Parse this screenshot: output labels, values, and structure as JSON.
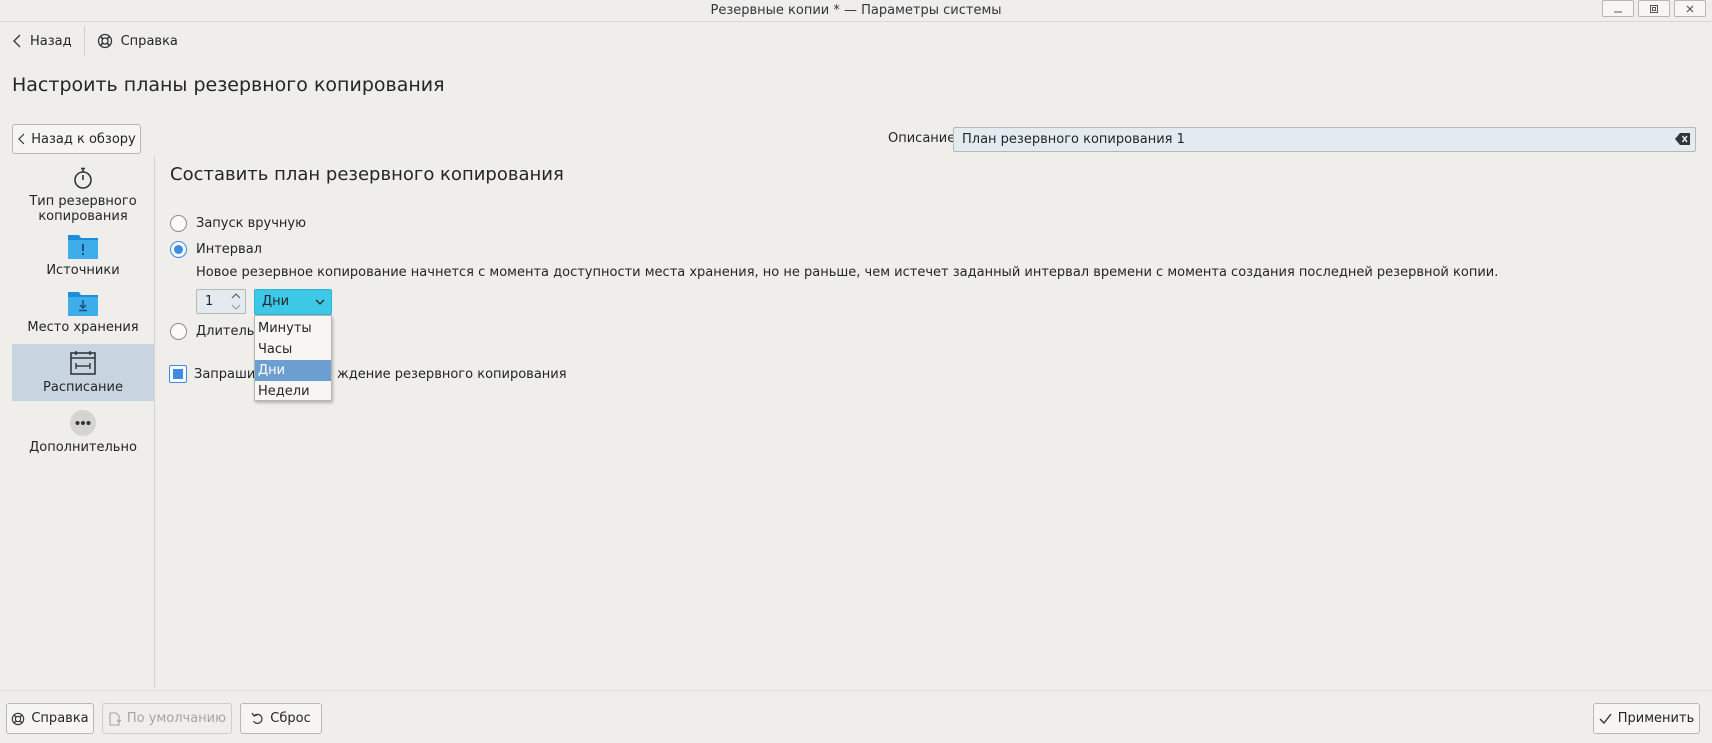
{
  "window": {
    "title": "Резервные копии * — Параметры системы"
  },
  "toolbar": {
    "back_label": "Назад",
    "help_label": "Справка"
  },
  "page": {
    "title": "Настроить планы резервного копирования",
    "back_to_overview_label": "Назад к обзору",
    "description_label": "Описание:",
    "description_value": "План резервного копирования 1"
  },
  "sidebar": {
    "items": [
      {
        "label": "Тип резервного копирования",
        "icon": "timer-icon"
      },
      {
        "label": "Источники",
        "icon": "folder-icon"
      },
      {
        "label": "Место хранения",
        "icon": "folder-download-icon"
      },
      {
        "label": "Расписание",
        "icon": "calendar-icon",
        "active": true
      },
      {
        "label": "Дополнительно",
        "icon": "more-icon"
      }
    ]
  },
  "schedule": {
    "section_title": "Составить план резервного копирования",
    "manual_label": "Запуск вручную",
    "interval_label": "Интервал",
    "interval_description": "Новое резервное копирование начнется с момента доступности места хранения, но не раньше, чем истечет заданный интервал времени с момента создания последней резервной копии.",
    "interval_value": "1",
    "interval_unit": "Дни",
    "unit_options": [
      "Минуты",
      "Часы",
      "Дни",
      "Недели"
    ],
    "usage_label_visible": "Длительн",
    "confirm_label_left": "Запрашив",
    "confirm_label_right": "ждение резервного копирования",
    "selected_mode": "Интервал",
    "confirm_checked": true
  },
  "footer": {
    "help_label": "Справка",
    "defaults_label": "По умолчанию",
    "reset_label": "Сброс",
    "apply_label": "Применить"
  },
  "colors": {
    "accent": "#3d8be6",
    "combo_bg": "#3ec8e7",
    "selection": "#6c9fd0",
    "window_bg": "#efeeea"
  }
}
